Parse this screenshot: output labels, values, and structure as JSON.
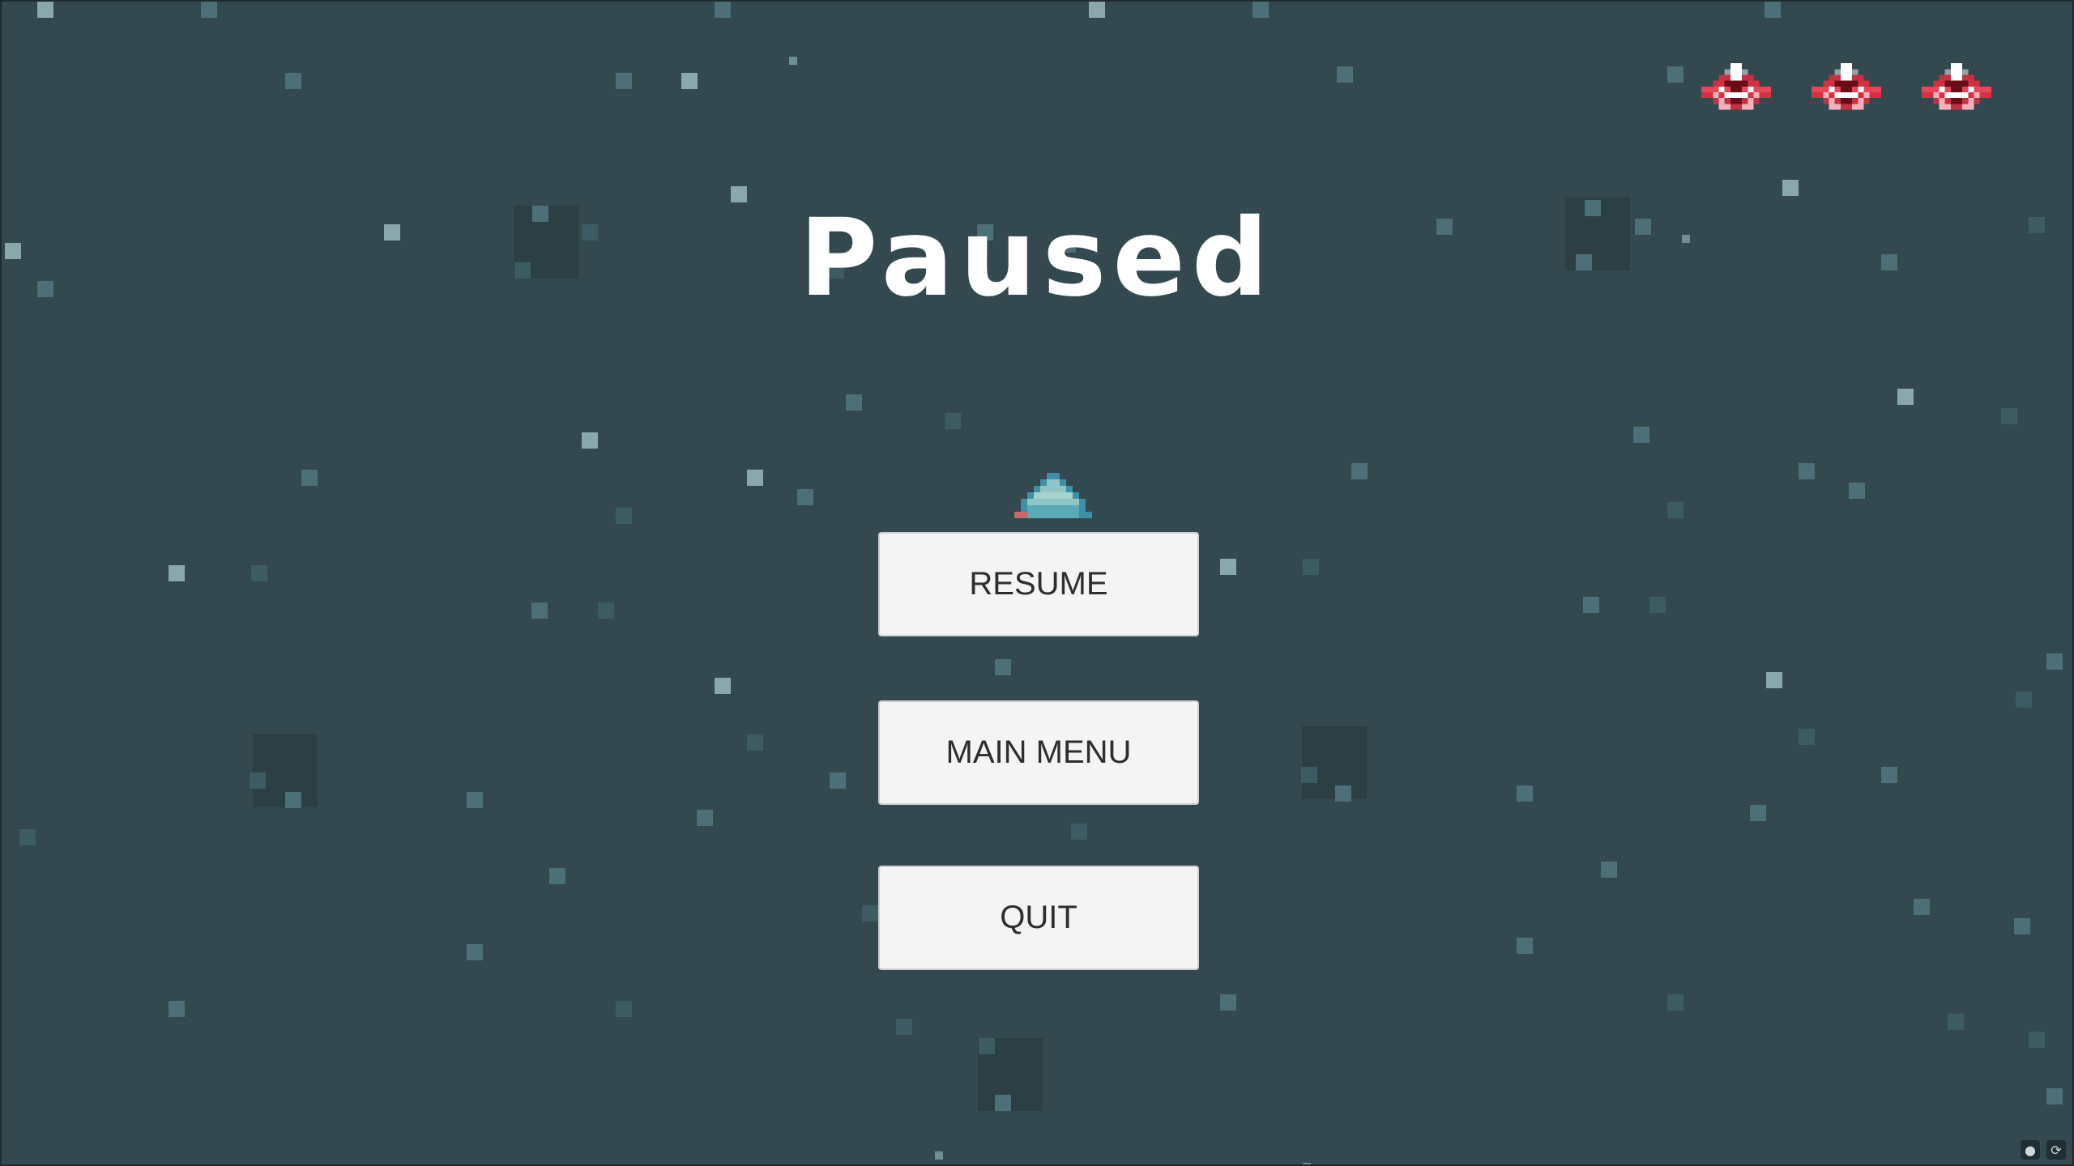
{
  "screen": {
    "title": "Paused"
  },
  "menu": {
    "resume_label": "RESUME",
    "main_menu_label": "MAIN MENU",
    "quit_label": "QUIT"
  },
  "hud": {
    "lives_count": 3,
    "life_icon": "enemy-ship-icon"
  },
  "player": {
    "icon": "player-ship-icon"
  },
  "corner": {
    "icons": [
      "microphone-icon",
      "refresh-icon"
    ]
  },
  "colors": {
    "background": "#33494f",
    "title": "#ffffff",
    "button_bg": "#f4f4f4",
    "button_text": "#2e2e2e",
    "life_red": "#d2323f",
    "life_dark": "#6a0d18",
    "ship_teal": "#5aaab8"
  }
}
